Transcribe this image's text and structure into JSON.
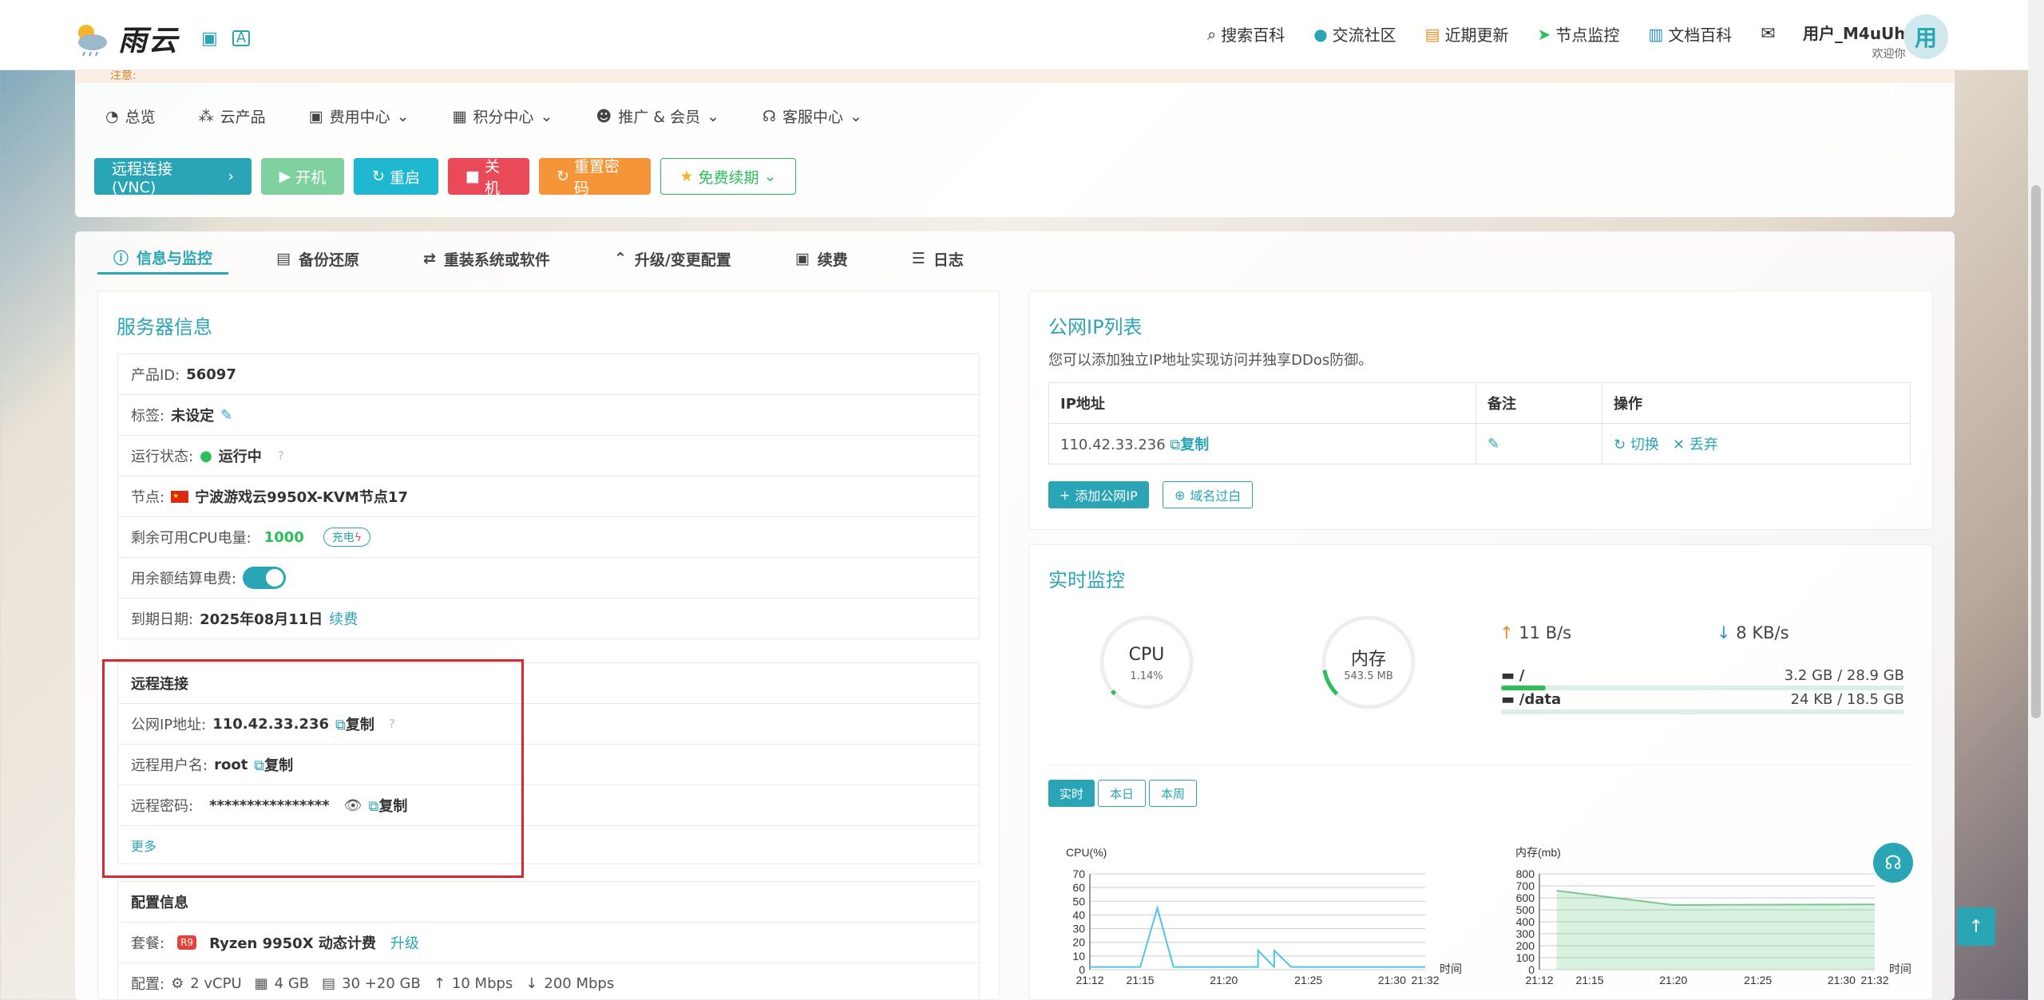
{
  "brand": {
    "name": "雨云"
  },
  "topnav": [
    {
      "icon": "search-icon",
      "label": "搜索百科"
    },
    {
      "icon": "community-icon",
      "label": "交流社区"
    },
    {
      "icon": "news-icon",
      "label": "近期更新"
    },
    {
      "icon": "plane-icon",
      "label": "节点监控"
    },
    {
      "icon": "book-icon",
      "label": "文档百科"
    }
  ],
  "user": {
    "name": "用户_M4uUh",
    "welcome": "欢迎你",
    "avatar": "用"
  },
  "notice": "注意:",
  "menu": [
    {
      "label": "总览"
    },
    {
      "label": "云产品"
    },
    {
      "label": "费用中心"
    },
    {
      "label": "积分中心"
    },
    {
      "label": "推广 & 会员"
    },
    {
      "label": "客服中心"
    }
  ],
  "buttons": {
    "vnc": "远程连接(VNC)",
    "start": "开机",
    "restart": "重启",
    "shutdown": "关机",
    "resetpw": "重置密码",
    "renew": "免费续期"
  },
  "tabs": [
    "信息与监控",
    "备份还原",
    "重装系统或软件",
    "升级/变更配置",
    "续费",
    "日志"
  ],
  "server": {
    "title": "服务器信息",
    "pid_label": "产品ID:",
    "pid": "56097",
    "tag_label": "标签:",
    "tag": "未设定",
    "status_label": "运行状态:",
    "status": "运行中",
    "node_label": "节点:",
    "node": "宁波游戏云9950X-KVM节点17",
    "cpu_label": "剩余可用CPU电量:",
    "cpu": "1000",
    "charge": "充电",
    "balance_label": "用余额结算电费:",
    "expire_label": "到期日期:",
    "expire": "2025年08月11日",
    "renew": "续费"
  },
  "remote": {
    "title": "远程连接",
    "ip_label": "公网IP地址:",
    "ip": "110.42.33.236",
    "copy": "复制",
    "user_label": "远程用户名:",
    "user": "root",
    "pw_label": "远程密码:",
    "pw": "****************",
    "more": "更多"
  },
  "config": {
    "title": "配置信息",
    "plan_label": "套餐:",
    "plan_badge": "R9",
    "plan": "Ryzen 9950X 动态计费",
    "upgrade": "升级",
    "spec_label": "配置:",
    "vcpu": "2 vCPU",
    "ram": "4 GB",
    "disk": "30 +20 GB",
    "up": "10 Mbps",
    "down": "200 Mbps"
  },
  "iplist": {
    "title": "公网IP列表",
    "desc": "您可以添加独立IP地址实现访问并独享DDos防御。",
    "cols": [
      "IP地址",
      "备注",
      "操作"
    ],
    "ip": "110.42.33.236",
    "copy": "复制",
    "switch": "切换",
    "abandon": "丢弃",
    "add": "添加公网IP",
    "domain": "域名过白"
  },
  "monitor": {
    "title": "实时监控",
    "cpu_name": "CPU",
    "cpu_val": "1.14%",
    "cpu_frac": 0.0114,
    "mem_name": "内存",
    "mem_val": "543.5 MB",
    "mem_frac": 0.13,
    "up": "11 B/s",
    "down": "8 KB/s",
    "disks": [
      {
        "name": "/",
        "val": "3.2 GB / 28.9 GB",
        "frac": 0.11
      },
      {
        "name": "/data",
        "val": "24 KB / 18.5 GB",
        "frac": 0.0
      }
    ],
    "ranges": [
      "实时",
      "本日",
      "本周"
    ]
  },
  "chart_data": [
    {
      "type": "line",
      "title": "CPU(%)",
      "xlabel": "时间",
      "ylim": [
        0,
        70
      ],
      "yticks": [
        0,
        10,
        20,
        30,
        40,
        50,
        60,
        70
      ],
      "xticks": [
        "21:12",
        "21:15",
        "21:20",
        "21:25",
        "21:30",
        "21:32"
      ],
      "x": [
        21.2,
        21.25,
        21.25,
        21.267,
        21.283,
        21.3,
        21.367,
        21.367,
        21.383,
        21.383,
        21.4,
        21.533
      ],
      "series": [
        {
          "values": [
            2,
            2,
            2,
            45,
            2,
            2,
            2,
            14,
            2,
            14,
            2,
            2
          ]
        }
      ]
    },
    {
      "type": "area",
      "title": "内存(mb)",
      "xlabel": "时间",
      "ylim": [
        0,
        800
      ],
      "yticks": [
        0,
        100,
        200,
        300,
        400,
        500,
        600,
        700,
        800
      ],
      "xticks": [
        "21:12",
        "21:15",
        "21:20",
        "21:25",
        "21:30",
        "21:32"
      ],
      "x": [
        21.217,
        21.333,
        21.533
      ],
      "series": [
        {
          "values": [
            660,
            540,
            545
          ]
        }
      ]
    }
  ],
  "colors": {
    "accent": "#2aa5b5"
  }
}
